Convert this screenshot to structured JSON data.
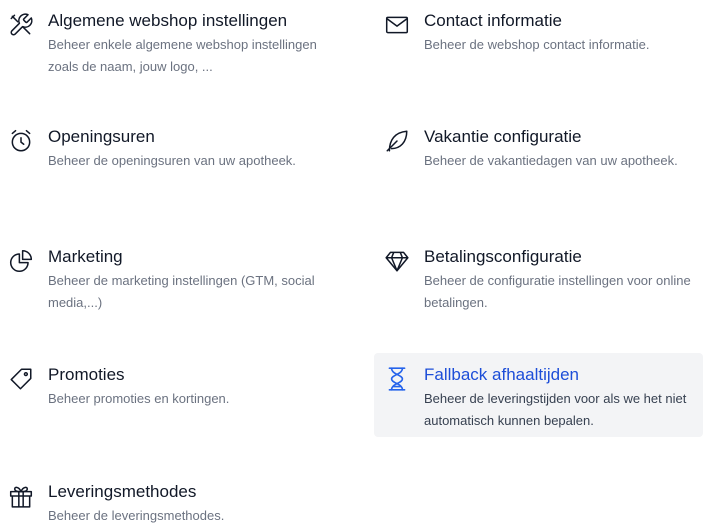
{
  "settings": {
    "algemeen": {
      "icon": "tools-icon",
      "title": "Algemene webshop instellingen",
      "description": "Beheer enkele algemene webshop instellingen zoals de naam, jouw logo, ..."
    },
    "contact": {
      "icon": "envelope-icon",
      "title": "Contact informatie",
      "description": "Beheer de webshop contact informatie."
    },
    "openingsuren": {
      "icon": "alarm-clock-icon",
      "title": "Openingsuren",
      "description": "Beheer de openingsuren van uw apotheek."
    },
    "vakantie": {
      "icon": "leaf-icon",
      "title": "Vakantie configuratie",
      "description": "Beheer de vakantiedagen van uw apotheek."
    },
    "marketing": {
      "icon": "pie-chart-icon",
      "title": "Marketing",
      "description": "Beheer de marketing instellingen (GTM, social media,...)"
    },
    "betaling": {
      "icon": "diamond-icon",
      "title": "Betalingsconfiguratie",
      "description": "Beheer de configuratie instellingen voor online betalingen."
    },
    "promoties": {
      "icon": "tag-icon",
      "title": "Promoties",
      "description": "Beheer promoties en kortingen."
    },
    "fallback": {
      "icon": "hourglass-icon",
      "title": "Fallback afhaaltijden",
      "description": "Beheer de leveringstijden voor als we het niet automatisch kunnen bepalen.",
      "highlighted": true
    },
    "levering": {
      "icon": "gift-icon",
      "title": "Leveringsmethodes",
      "description": "Beheer de leveringsmethodes."
    }
  },
  "colors": {
    "title": "#111827",
    "description": "#6b7280",
    "active_title": "#1d4ed8",
    "active_background": "#f3f4f6"
  }
}
